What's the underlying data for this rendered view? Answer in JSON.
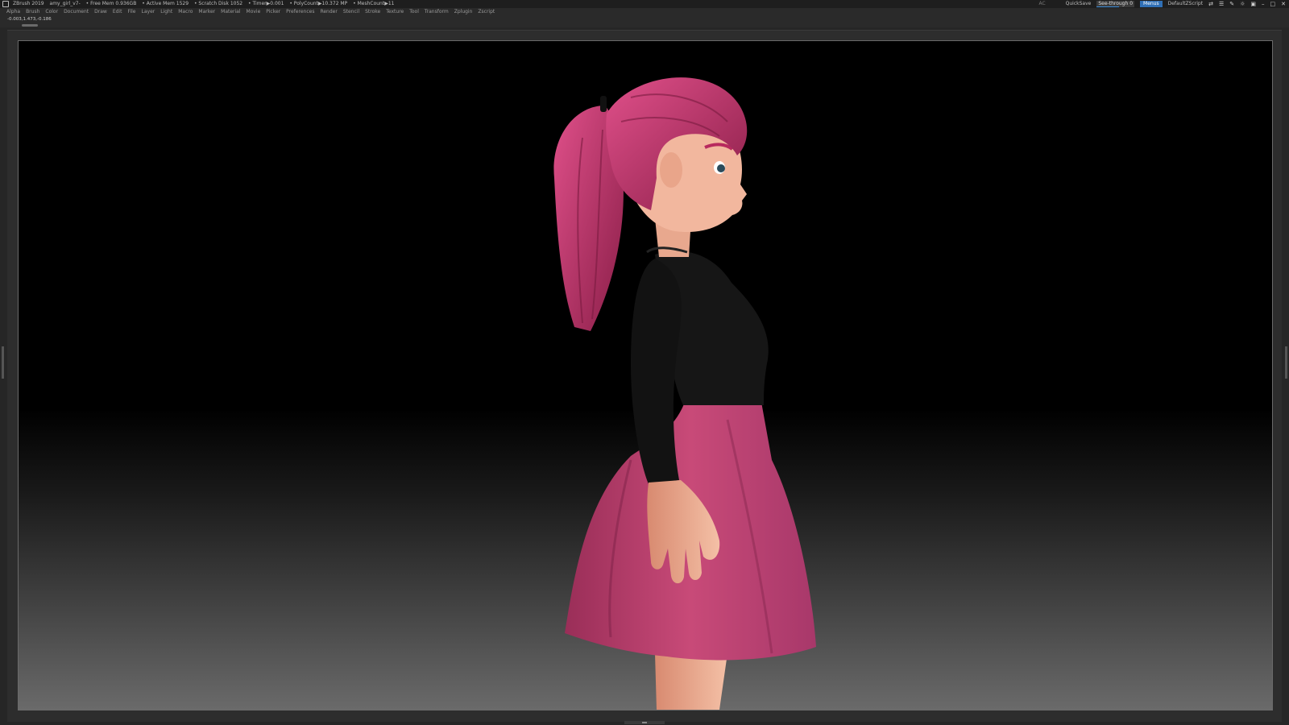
{
  "titlebar": {
    "app_name": "ZBrush 2019",
    "file_name": "amy_girl_v7-",
    "free_mem": "• Free Mem 0.936GB",
    "active_mem": "• Active Mem 1529",
    "scratch_disk": "• Scratch Disk 1052",
    "timer": "• Timer▶0.001",
    "poly_count": "• PolyCount▶10.372 MP",
    "mesh_count": "• MeshCount▶11",
    "ac_label": "AC",
    "quicksave_label": "QuickSave",
    "see_through_label": "See-through 0",
    "see_through_level": 0,
    "menus_label": "Menus",
    "script_label": "DefaultZScript"
  },
  "menubar": {
    "items": [
      "Alpha",
      "Brush",
      "Color",
      "Document",
      "Draw",
      "Edit",
      "File",
      "Layer",
      "Light",
      "Macro",
      "Marker",
      "Material",
      "Movie",
      "Picker",
      "Preferences",
      "Render",
      "Stencil",
      "Stroke",
      "Texture",
      "Tool",
      "Transform",
      "Zplugin",
      "Zscript"
    ]
  },
  "status": {
    "coordinates": "-0.003,1.473,-0.186"
  },
  "colors": {
    "accent": "#2f6fb5",
    "hair": "#c8386c",
    "skirt": "#c84a78",
    "shirt": "#171717",
    "skin": "#f0b49a"
  },
  "icons": {
    "logo": "zbrush-logo-icon",
    "window": [
      "layout-icon",
      "menu-icon",
      "brush-icon",
      "light-icon",
      "lock-icon",
      "minimize-icon",
      "maximize-icon",
      "close-icon"
    ]
  }
}
